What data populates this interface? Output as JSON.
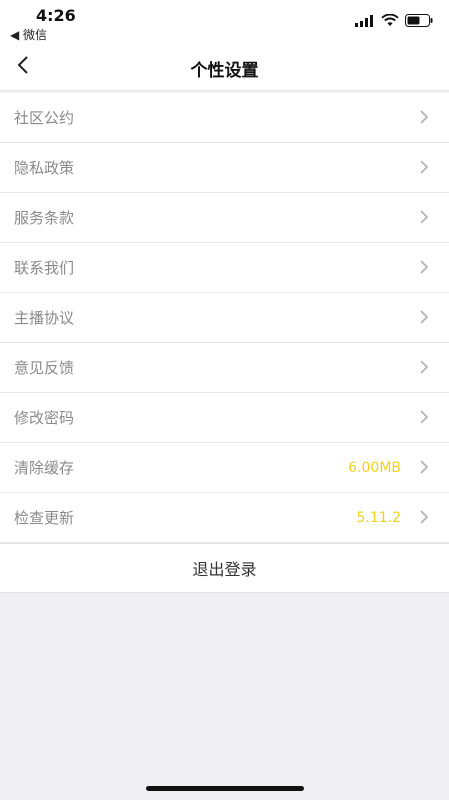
{
  "status_bar": {
    "time": "4:26",
    "back_app": "◀ 微信"
  },
  "nav": {
    "title": "个性设置"
  },
  "settings": {
    "items": [
      {
        "label": "社区公约",
        "value": ""
      },
      {
        "label": "隐私政策",
        "value": ""
      },
      {
        "label": "服务条款",
        "value": ""
      },
      {
        "label": "联系我们",
        "value": ""
      },
      {
        "label": "主播协议",
        "value": ""
      },
      {
        "label": "意见反馈",
        "value": ""
      },
      {
        "label": "修改密码",
        "value": ""
      },
      {
        "label": "清除缓存",
        "value": "6.00MB"
      },
      {
        "label": "检查更新",
        "value": "5.11.2"
      }
    ]
  },
  "logout": {
    "label": "退出登录"
  },
  "colors": {
    "accent_value": "#f2d21c",
    "label_gray": "#8a8a8a",
    "background": "#efeff4"
  }
}
